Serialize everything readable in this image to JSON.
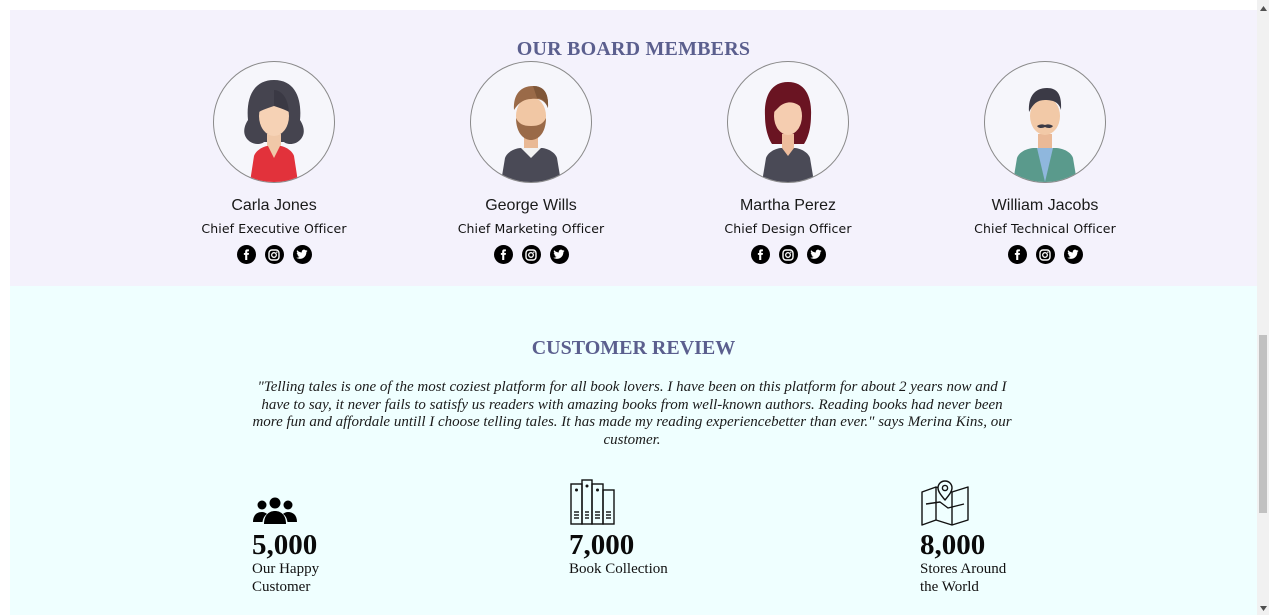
{
  "board": {
    "title": "OUR BOARD MEMBERS",
    "members": [
      {
        "name": "Carla Jones",
        "role": "Chief Executive Officer"
      },
      {
        "name": "George Wills",
        "role": "Chief Marketing Officer"
      },
      {
        "name": "Martha Perez",
        "role": "Chief Design Officer"
      },
      {
        "name": "William Jacobs",
        "role": "Chief Technical Officer"
      }
    ],
    "social_icons": [
      "facebook-icon",
      "instagram-icon",
      "twitter-icon"
    ]
  },
  "review": {
    "title": "CUSTOMER REVIEW",
    "quote": "\"Telling tales is one of the most coziest platform for all book lovers. I have been on this platform for about 2 years now and I have to say, it never fails to satisfy us readers with amazing books from well-known authors. Reading books had never been more fun and affordale untill I choose telling tales. It has made my reading experiencebetter than ever.\" says Merina Kins, our customer."
  },
  "stats": [
    {
      "icon": "users-icon",
      "value": "5,000",
      "label": "Our Happy Customer"
    },
    {
      "icon": "books-icon",
      "value": "7,000",
      "label": "Book Collection"
    },
    {
      "icon": "map-icon",
      "value": "8,000",
      "label": "Stores Around the World"
    }
  ],
  "colors": {
    "heading": "#5b5f8e",
    "board_bg": "#f4f2fc",
    "review_bg": "#efffff"
  }
}
